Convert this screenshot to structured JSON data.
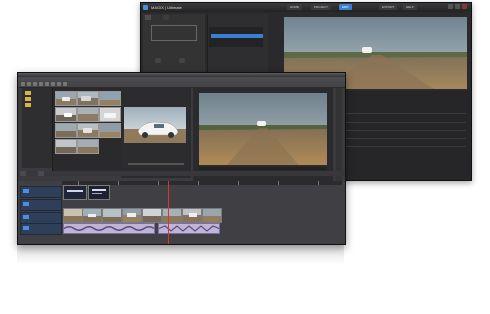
{
  "back_window": {
    "app_title": "MAGIX | Ultimate",
    "nav": [
      "HOME",
      "PROJECT",
      "EDIT",
      "EXPORT",
      "HELP"
    ],
    "tabs": [
      "",
      ""
    ],
    "dropzone_text": "",
    "buttons": [
      "",
      ""
    ],
    "files": [
      "",
      "",
      ""
    ]
  },
  "front_window": {
    "menu": [
      "",
      "",
      "",
      "",
      "",
      "",
      "",
      "",
      ""
    ],
    "bottom_tabs": [
      "",
      ""
    ]
  },
  "colors": {
    "accent": "#3a7fd0",
    "window_dark": "#2a2a2c",
    "timeline_track_blue": "#2f3f5a",
    "audio_clip": "#bfb4d6"
  }
}
